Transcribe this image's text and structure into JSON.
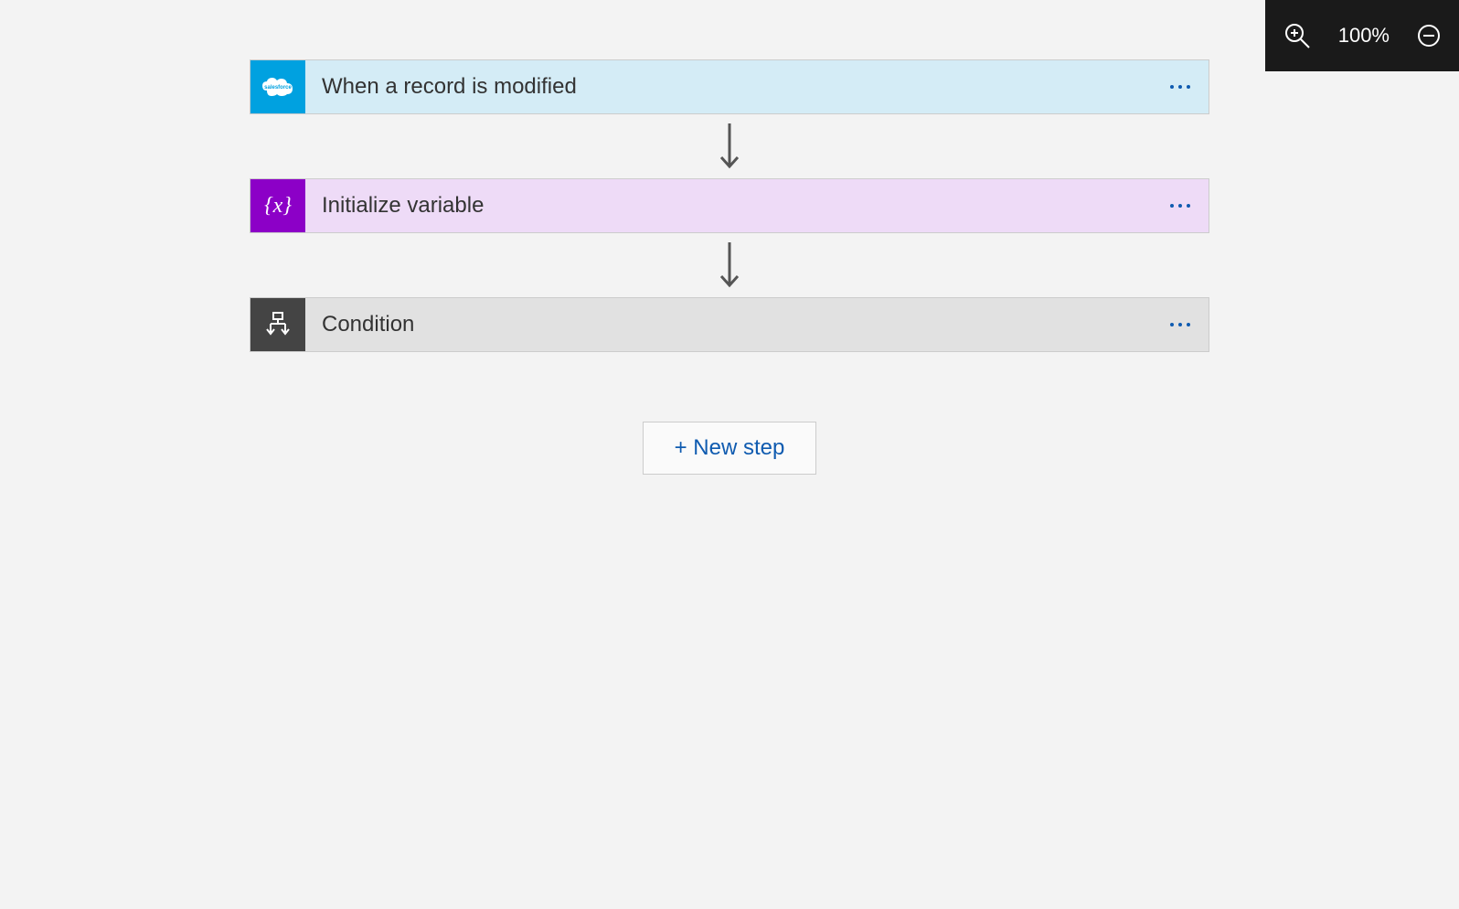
{
  "zoom": {
    "level": "100%"
  },
  "steps": [
    {
      "title": "When a record is modified",
      "icon": "salesforce-icon"
    },
    {
      "title": "Initialize variable",
      "icon": "variable-icon"
    },
    {
      "title": "Condition",
      "icon": "condition-icon"
    }
  ],
  "buttons": {
    "newStep": "+ New step"
  }
}
